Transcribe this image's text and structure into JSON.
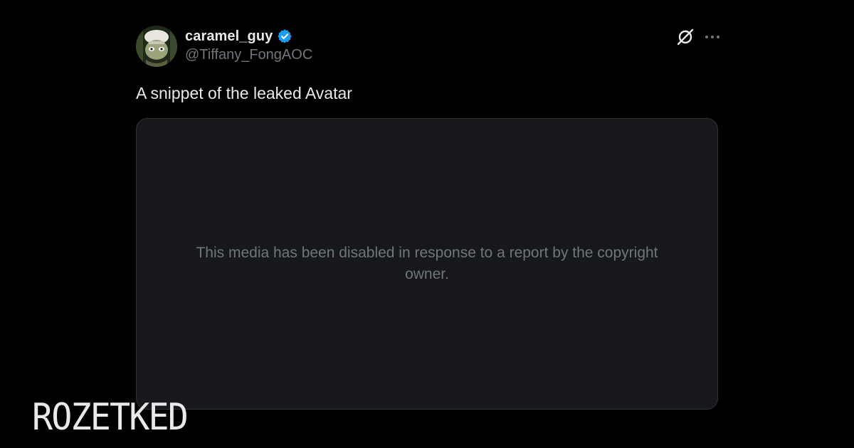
{
  "tweet": {
    "display_name": "caramel_guy",
    "handle": "@Tiffany_FongAOC",
    "text": "A snippet of the leaked Avatar",
    "media_notice": "This media has been disabled in response to a report by the copyright owner."
  },
  "icons": {
    "verified": "verified-badge-icon",
    "grok": "slashed-circle-icon",
    "more": "more-icon"
  },
  "watermark": {
    "text": "ROZETKED"
  },
  "colors": {
    "background": "#000000",
    "primary_text": "#e7e9ea",
    "secondary_text": "#71767b",
    "card_background": "#16181c",
    "card_border": "#2f3336",
    "verified_blue": "#1d9bf0"
  }
}
